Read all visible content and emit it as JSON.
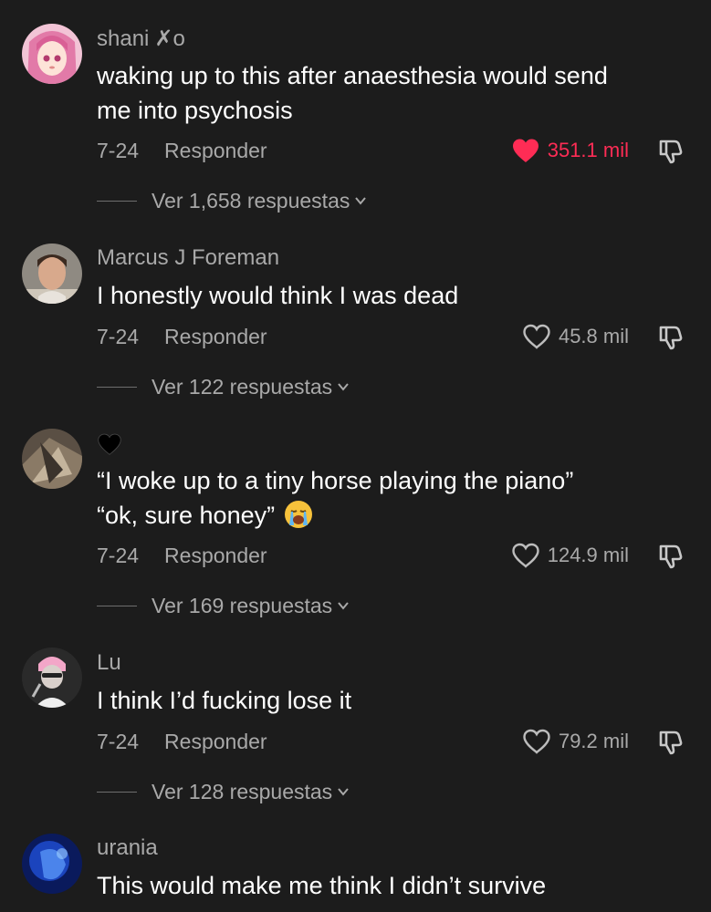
{
  "comments": [
    {
      "username": "shani",
      "username_suffix": "✗o",
      "text_lines": [
        "waking up to this after anaesthesia would send",
        "me into psychosis"
      ],
      "date": "7-24",
      "reply_label": "Responder",
      "likes": "351.1 mil",
      "liked": true,
      "replies_label": "Ver 1,658 respuestas"
    },
    {
      "username": "Marcus J Foreman",
      "text_lines": [
        "I honestly would think I was dead"
      ],
      "date": "7-24",
      "reply_label": "Responder",
      "likes": "45.8 mil",
      "liked": false,
      "replies_label": "Ver 122 respuestas"
    },
    {
      "username_emoji": "black-heart",
      "text_lines": [
        "“I woke up to a tiny horse playing the piano”",
        "“ok, sure honey”"
      ],
      "text_emoji": "loudly-crying-face",
      "date": "7-24",
      "reply_label": "Responder",
      "likes": "124.9 mil",
      "liked": false,
      "replies_label": "Ver 169 respuestas"
    },
    {
      "username": "Lu",
      "text_lines": [
        "I think I’d fucking lose it"
      ],
      "date": "7-24",
      "reply_label": "Responder",
      "likes": "79.2 mil",
      "liked": false,
      "replies_label": "Ver 128 respuestas"
    },
    {
      "username": "urania",
      "text_lines": [
        "This would make me think I didn’t survive"
      ]
    }
  ],
  "colors": {
    "background": "#1c1c1c",
    "text_primary": "#ffffff",
    "text_secondary": "#a9a9a9",
    "like_active": "#fe2c55"
  }
}
